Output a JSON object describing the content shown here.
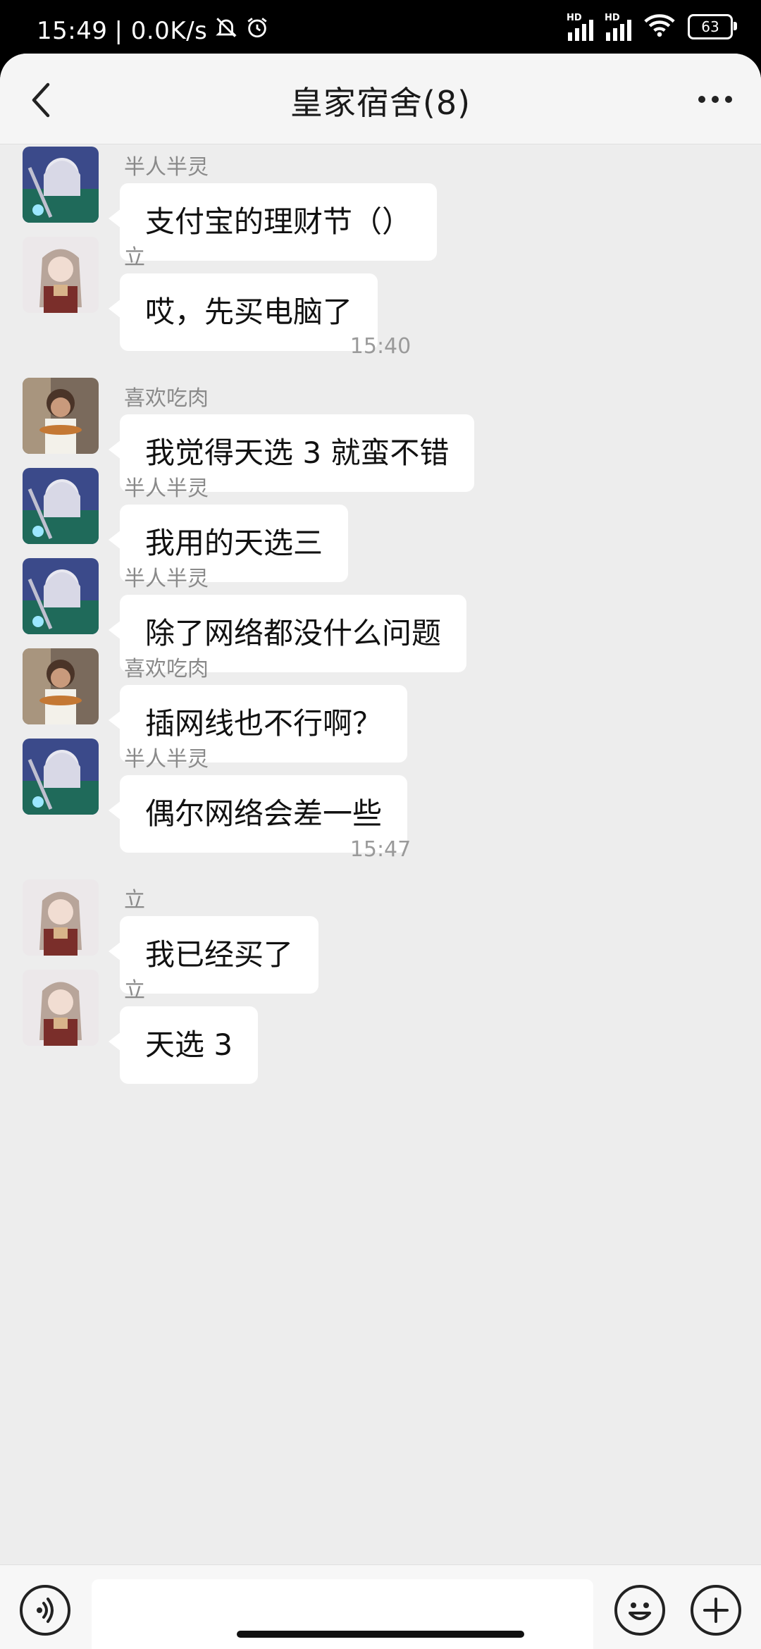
{
  "status_bar": {
    "time": "15:49",
    "speed": "| 0.0K/s",
    "battery": "63",
    "hd1": "HD",
    "hd2": "HD"
  },
  "header": {
    "title": "皇家宿舍(8)"
  },
  "messages": [
    {
      "sender": "半人半灵",
      "text": "支付宝的理财节（）",
      "avatar": "silver-hair-anime-avatar"
    },
    {
      "sender": "立",
      "text": "哎，先买电脑了",
      "avatar": "brown-hair-anime-avatar"
    },
    {
      "sender": "喜欢吃肉",
      "text": "我觉得天选 3 就蛮不错",
      "avatar": "photo-avatar"
    },
    {
      "sender": "半人半灵",
      "text": "我用的天选三",
      "avatar": "silver-hair-anime-avatar"
    },
    {
      "sender": "半人半灵",
      "text": "除了网络都没什么问题",
      "avatar": "silver-hair-anime-avatar"
    },
    {
      "sender": "喜欢吃肉",
      "text": "插网线也不行啊？",
      "avatar": "photo-avatar"
    },
    {
      "sender": "半人半灵",
      "text": "偶尔网络会差一些",
      "avatar": "silver-hair-anime-avatar"
    },
    {
      "sender": "立",
      "text": "我已经买了",
      "avatar": "brown-hair-anime-avatar"
    },
    {
      "sender": "立",
      "text": "天选 3",
      "avatar": "brown-hair-anime-avatar"
    }
  ],
  "timestamps": [
    "15:40",
    "15:47"
  ],
  "input": {
    "value": "",
    "placeholder": ""
  },
  "colors": {
    "chat_background": "#ededed",
    "bubble": "#ffffff",
    "header": "#f5f5f5"
  }
}
